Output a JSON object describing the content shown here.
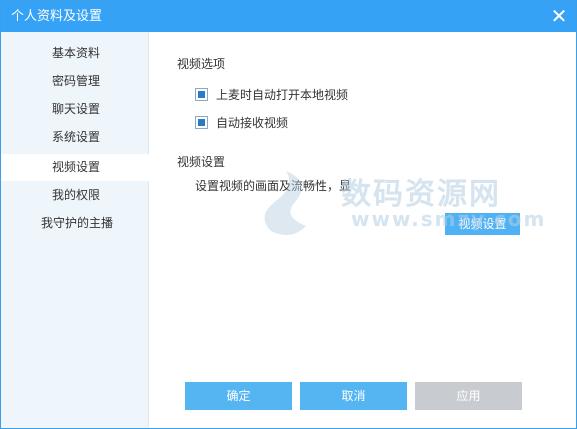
{
  "window": {
    "title": "个人资料及设置",
    "close_icon": "close-icon"
  },
  "sidebar": {
    "items": [
      {
        "label": "基本资料",
        "active": false
      },
      {
        "label": "密码管理",
        "active": false
      },
      {
        "label": "聊天设置",
        "active": false
      },
      {
        "label": "系统设置",
        "active": false
      },
      {
        "label": "视频设置",
        "active": true
      },
      {
        "label": "我的权限",
        "active": false
      },
      {
        "label": "我守护的主播",
        "active": false
      }
    ]
  },
  "video_options": {
    "title": "视频选项",
    "options": [
      {
        "label": "上麦时自动打开本地视频",
        "checked": true
      },
      {
        "label": "自动接收视频",
        "checked": true
      }
    ]
  },
  "video_settings": {
    "title": "视频设置",
    "description": "设置视频的画面及流畅性，显",
    "button_label": "视频设置"
  },
  "footer": {
    "ok_label": "确定",
    "cancel_label": "取消",
    "apply_label": "应用"
  },
  "watermark": {
    "text": "数码资源网",
    "url": "www.smzy.com"
  },
  "colors": {
    "titlebar": "#36a2f5",
    "button": "#55b5f2",
    "button_disabled": "#c8cbcf",
    "sidebar_bg": "#eef5fb"
  }
}
